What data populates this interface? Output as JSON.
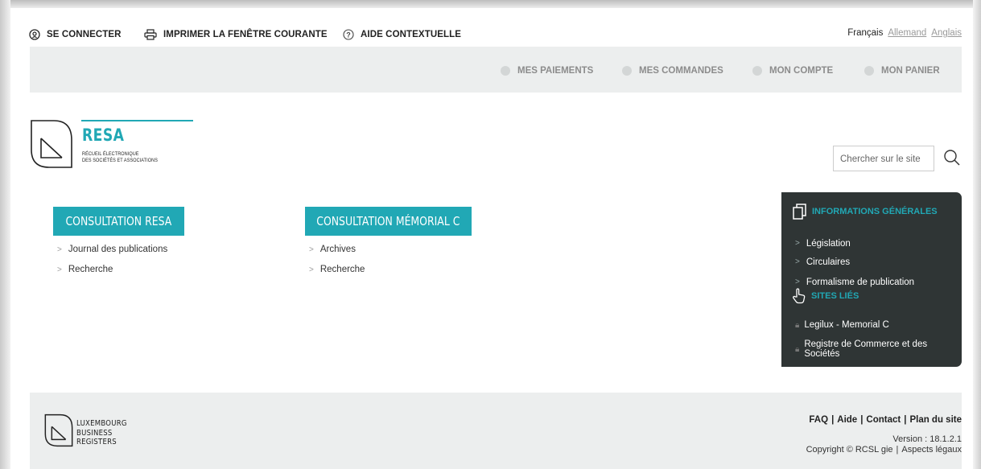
{
  "topbar": {
    "login_label": "SE CONNECTER",
    "print_label": "IMPRIMER LA FENÊTRE COURANTE",
    "help_label": "AIDE CONTEXTUELLE",
    "languages": {
      "current": "Français",
      "german": "Allemand",
      "english": "Anglais"
    }
  },
  "nav": {
    "payments": "MES PAIEMENTS",
    "orders": "MES COMMANDES",
    "account": "MON COMPTE",
    "cart": "MON PANIER"
  },
  "logo": {
    "title": "RESA",
    "subtitle_line1": "Récueil électronique",
    "subtitle_line2": "des sociétés et associations"
  },
  "search": {
    "placeholder": "Chercher sur le site"
  },
  "consultation_resa": {
    "button_label": "CONSULTATION RESA",
    "links": [
      "Journal des publications",
      "Recherche"
    ]
  },
  "consultation_memorial": {
    "button_label": "CONSULTATION MÉMORIAL C",
    "links": [
      "Archives",
      "Recherche"
    ]
  },
  "info_panel": {
    "heading": "INFORMATIONS GÉNÉRALES",
    "links": [
      "Législation",
      "Circulaires",
      "Formalisme de publication"
    ],
    "related_heading": "SITES LIÉS",
    "related_links": [
      "Legilux - Memorial C",
      "Registre de Commerce et des Sociétés"
    ]
  },
  "footer": {
    "logo_lines": [
      "Luxembourg",
      "Business",
      "Registers"
    ],
    "links": [
      "FAQ",
      "Aide",
      "Contact",
      "Plan du site"
    ],
    "separator": "|",
    "version": "Version : 18.1.2.1",
    "copyright": "Copyright © RCSL gie",
    "legal": "Aspects légaux"
  },
  "colors": {
    "accent": "#21a8b5",
    "panel_bg": "#2f3535",
    "band_bg": "#eceeee"
  }
}
